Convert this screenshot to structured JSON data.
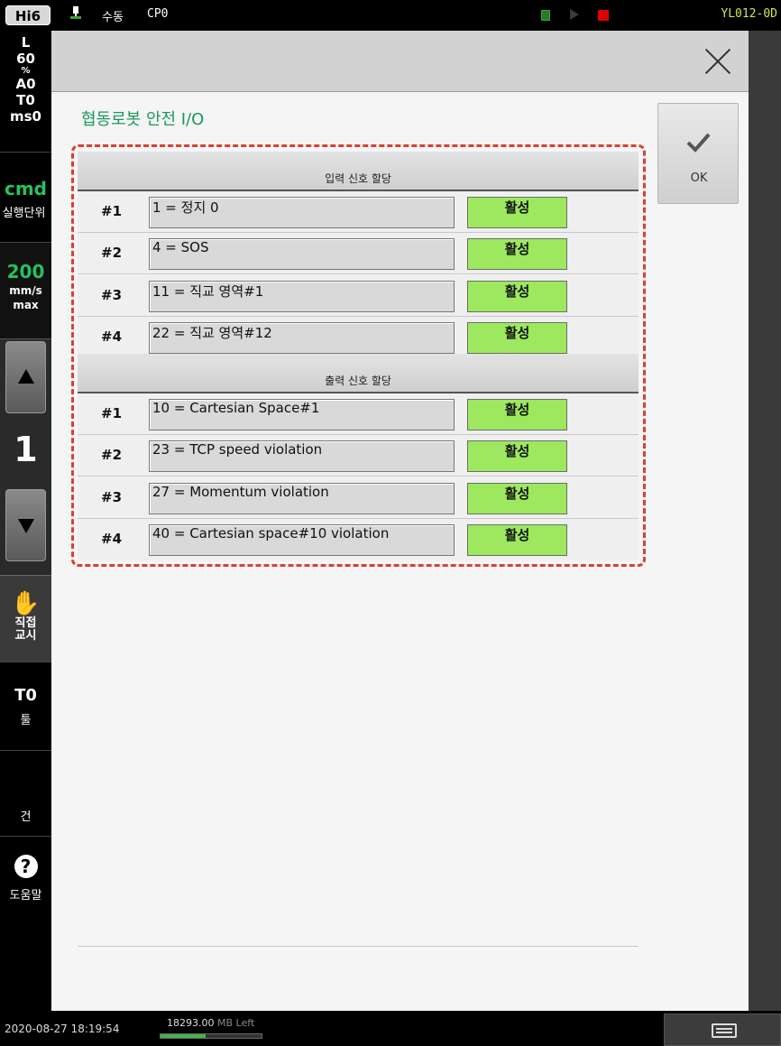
{
  "topbar": {
    "brand": "Hi6",
    "mode": "수동",
    "cp": "CP0",
    "version": "YL012-0D"
  },
  "sidebar": {
    "status": {
      "line1": "L",
      "line2": "60",
      "line3": "%",
      "line4": "A0",
      "line5": "T0",
      "line6": "ms0"
    },
    "cmd": {
      "value": "cmd",
      "label": "실행단위"
    },
    "speed": {
      "value": "200",
      "unit1": "mm/s",
      "unit2": "max"
    },
    "jog_step": "1",
    "direct": {
      "label1": "직접",
      "label2": "교시"
    },
    "tool": {
      "value": "T0",
      "label": "툴"
    },
    "gun": {
      "label": "건"
    },
    "help": {
      "icon_text": "?",
      "label": "도움말"
    }
  },
  "dialog": {
    "title": "협동로봇 안전 I/O",
    "ok_label": "OK",
    "input_section": "입력 신호 할당",
    "output_section": "출력 신호 할당",
    "inputs": [
      {
        "num": "#1",
        "value": "1 = 정지 0",
        "status": "활성"
      },
      {
        "num": "#2",
        "value": "4 = SOS",
        "status": "활성"
      },
      {
        "num": "#3",
        "value": "11 = 직교 영역#1",
        "status": "활성"
      },
      {
        "num": "#4",
        "value": "22 = 직교 영역#12",
        "status": "활성"
      }
    ],
    "outputs": [
      {
        "num": "#1",
        "value": "10 = Cartesian Space#1",
        "status": "활성"
      },
      {
        "num": "#2",
        "value": "23 = TCP speed violation",
        "status": "활성"
      },
      {
        "num": "#3",
        "value": "27 = Momentum violation",
        "status": "활성"
      },
      {
        "num": "#4",
        "value": "40 = Cartesian space#10 violation",
        "status": "활성"
      }
    ]
  },
  "bottombar": {
    "datetime": "2020-08-27 18:19:54",
    "memory_value": "18293.00",
    "memory_unit": "MB Left",
    "memory_fill": 0.45
  },
  "colors": {
    "title_green": "#1a9a5a",
    "active_green": "#9de85f",
    "highlight_red": "#d9412f",
    "sidebar_green": "#28c060"
  }
}
